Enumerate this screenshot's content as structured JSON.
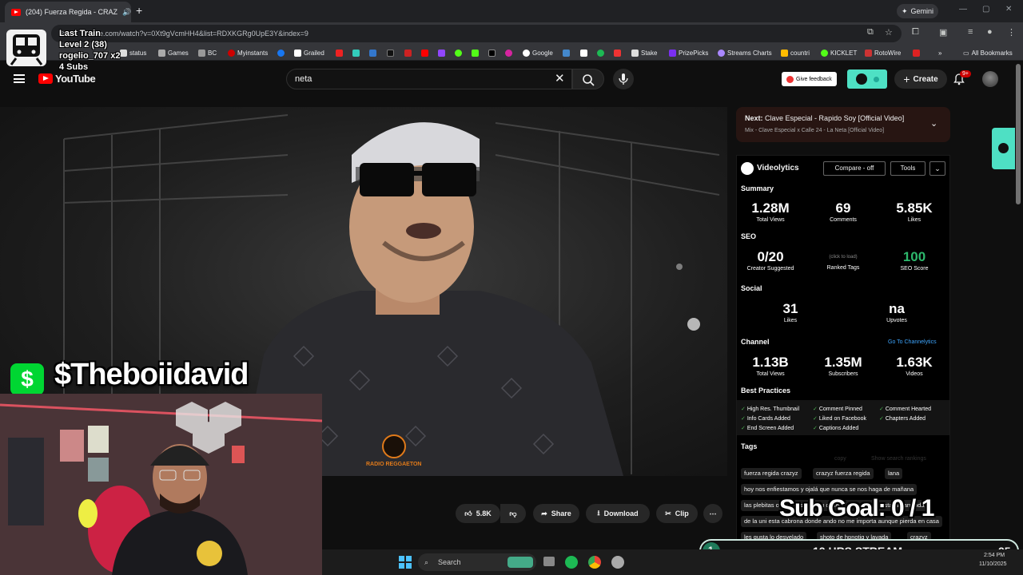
{
  "browser": {
    "tab_title": "(204) Fuerza Regida - CRAZ",
    "new_tab": "+",
    "gemini_label": "Gemini",
    "url": "ube.com/watch?v=0Xt9gVcmHH4&list=RDXKGRg0UpE3Y&index=9",
    "bookmarks": [
      "status",
      "Games",
      "BC",
      "Myinstants",
      "Grailed",
      "Google",
      "Stake",
      "PrizePicks",
      "Streams Charts",
      "countri",
      "KICKLET",
      "RotoWire"
    ],
    "all_bookmarks": "All Bookmarks"
  },
  "youtube": {
    "logo_text": "YouTube",
    "search_value": "neta",
    "feedback_label": "Give feedback",
    "create_label": "Create",
    "notif_count": "9+",
    "actions": {
      "like_count": "5.8K",
      "share": "Share",
      "download": "Download",
      "clip": "Clip"
    },
    "video_watermark": "RADIO REGGAETON"
  },
  "next_box": {
    "next_prefix": "Next:",
    "next_title": "Clave Especial - Rapido Soy [Official Video]",
    "mix_title": "Mix - Clave Especial x Calle 24 - La Neta [Official Video]"
  },
  "videolytics": {
    "brand": "Videolytics",
    "compare": "Compare - off",
    "tools": "Tools",
    "summary": {
      "title": "Summary",
      "views": "1.28M",
      "views_label": "Total Views",
      "comments": "69",
      "comments_label": "Comments",
      "likes": "5.85K",
      "likes_label": "Likes"
    },
    "seo": {
      "title": "SEO",
      "creator": "0/20",
      "creator_label": "Creator Suggested",
      "ranked_hint": "(click to load)",
      "ranked_label": "Ranked Tags",
      "score": "100",
      "score_label": "SEO Score"
    },
    "social": {
      "title": "Social",
      "likes": "31",
      "likes_label": "Likes",
      "upvotes": "na",
      "upvotes_label": "Upvotes"
    },
    "channel": {
      "title": "Channel",
      "link": "Go To Channelytics",
      "views": "1.13B",
      "views_label": "Total Views",
      "subs": "1.35M",
      "subs_label": "Subscribers",
      "videos": "1.63K",
      "videos_label": "Videos"
    },
    "best_practices": {
      "title": "Best Practices",
      "items": [
        "High Res. Thumbnail",
        "Comment Pinned",
        "Comment Hearted",
        "Info Cards Added",
        "Liked on Facebook",
        "Chapters Added",
        "End Screen Added",
        "Captions Added"
      ]
    },
    "tags": {
      "title": "Tags",
      "copy": "copy",
      "show_rankings": "Show search rankings",
      "items": [
        "fuerza regida crazyz",
        "crazyz fuerza regida",
        "lana",
        "hoy nos enfiestamos y ojalá que nunca se nos haga de mañana",
        "las plebitas conmigo se besan de lengua igual les gusta la parranda",
        "de la uni esta cabrona donde ando no me importa aunque pierda en casa",
        "les gusta lo desvelado",
        "shoto de hpnotiq y lavada",
        "crazyz"
      ]
    }
  },
  "stream_overlay": {
    "train_title": "Last Train",
    "train_level": "Level 2  (38)",
    "train_user": "rogelio_707 x2",
    "train_subs": "4 Subs",
    "cashtag_symbol": "$",
    "cashtag": "$Theboiidavid",
    "sub_goal": "Sub Goal:  0 / 1",
    "stream_level": "1",
    "stream_label": "12 HRS STREAM",
    "stream_goal": "25"
  },
  "taskbar": {
    "search_label": "Search",
    "time": "2:54 PM",
    "date": "11/10/2025"
  }
}
